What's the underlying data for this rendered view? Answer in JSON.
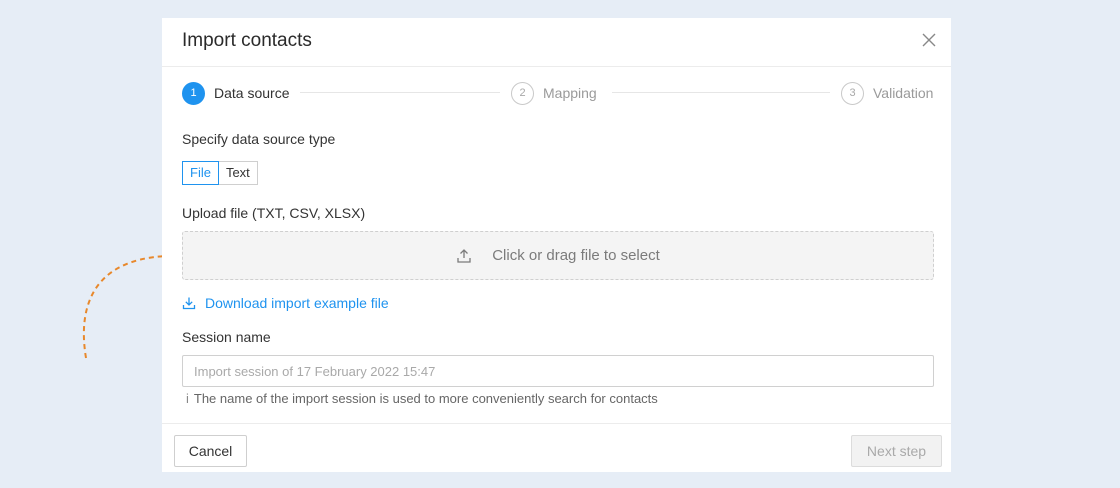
{
  "modal": {
    "title": "Import contacts"
  },
  "stepper": {
    "steps": [
      {
        "number": "1",
        "label": "Data source",
        "state": "active"
      },
      {
        "number": "2",
        "label": "Mapping",
        "state": "idle"
      },
      {
        "number": "3",
        "label": "Validation",
        "state": "idle"
      }
    ]
  },
  "source_type": {
    "label": "Specify data source type",
    "options": [
      "File",
      "Text"
    ],
    "selected": "File"
  },
  "upload": {
    "label": "Upload file (TXT, CSV, XLSX)",
    "dropzone_text": "Click or drag file to select",
    "icon": "upload-icon"
  },
  "download_example": {
    "label": "Download import example file",
    "icon": "download-icon"
  },
  "session": {
    "label": "Session name",
    "placeholder": "Import session of 17 February 2022 15:47",
    "value": "",
    "hint": "The name of the import session is used to more conveniently search for contacts",
    "hint_icon": "i"
  },
  "footer": {
    "cancel_label": "Cancel",
    "next_label": "Next step"
  },
  "colors": {
    "accent": "#1f93ef",
    "annotation": "#e8882b",
    "background": "#e6edf6"
  }
}
